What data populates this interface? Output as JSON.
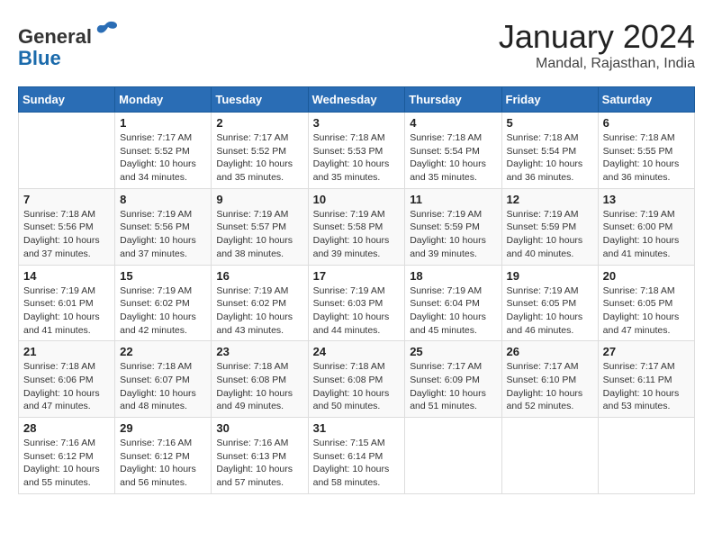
{
  "header": {
    "logo_line1": "General",
    "logo_line2": "Blue",
    "month": "January 2024",
    "location": "Mandal, Rajasthan, India"
  },
  "days_of_week": [
    "Sunday",
    "Monday",
    "Tuesday",
    "Wednesday",
    "Thursday",
    "Friday",
    "Saturday"
  ],
  "weeks": [
    [
      {
        "day": "",
        "info": ""
      },
      {
        "day": "1",
        "info": "Sunrise: 7:17 AM\nSunset: 5:52 PM\nDaylight: 10 hours\nand 34 minutes."
      },
      {
        "day": "2",
        "info": "Sunrise: 7:17 AM\nSunset: 5:52 PM\nDaylight: 10 hours\nand 35 minutes."
      },
      {
        "day": "3",
        "info": "Sunrise: 7:18 AM\nSunset: 5:53 PM\nDaylight: 10 hours\nand 35 minutes."
      },
      {
        "day": "4",
        "info": "Sunrise: 7:18 AM\nSunset: 5:54 PM\nDaylight: 10 hours\nand 35 minutes."
      },
      {
        "day": "5",
        "info": "Sunrise: 7:18 AM\nSunset: 5:54 PM\nDaylight: 10 hours\nand 36 minutes."
      },
      {
        "day": "6",
        "info": "Sunrise: 7:18 AM\nSunset: 5:55 PM\nDaylight: 10 hours\nand 36 minutes."
      }
    ],
    [
      {
        "day": "7",
        "info": "Sunrise: 7:18 AM\nSunset: 5:56 PM\nDaylight: 10 hours\nand 37 minutes."
      },
      {
        "day": "8",
        "info": "Sunrise: 7:19 AM\nSunset: 5:56 PM\nDaylight: 10 hours\nand 37 minutes."
      },
      {
        "day": "9",
        "info": "Sunrise: 7:19 AM\nSunset: 5:57 PM\nDaylight: 10 hours\nand 38 minutes."
      },
      {
        "day": "10",
        "info": "Sunrise: 7:19 AM\nSunset: 5:58 PM\nDaylight: 10 hours\nand 39 minutes."
      },
      {
        "day": "11",
        "info": "Sunrise: 7:19 AM\nSunset: 5:59 PM\nDaylight: 10 hours\nand 39 minutes."
      },
      {
        "day": "12",
        "info": "Sunrise: 7:19 AM\nSunset: 5:59 PM\nDaylight: 10 hours\nand 40 minutes."
      },
      {
        "day": "13",
        "info": "Sunrise: 7:19 AM\nSunset: 6:00 PM\nDaylight: 10 hours\nand 41 minutes."
      }
    ],
    [
      {
        "day": "14",
        "info": "Sunrise: 7:19 AM\nSunset: 6:01 PM\nDaylight: 10 hours\nand 41 minutes."
      },
      {
        "day": "15",
        "info": "Sunrise: 7:19 AM\nSunset: 6:02 PM\nDaylight: 10 hours\nand 42 minutes."
      },
      {
        "day": "16",
        "info": "Sunrise: 7:19 AM\nSunset: 6:02 PM\nDaylight: 10 hours\nand 43 minutes."
      },
      {
        "day": "17",
        "info": "Sunrise: 7:19 AM\nSunset: 6:03 PM\nDaylight: 10 hours\nand 44 minutes."
      },
      {
        "day": "18",
        "info": "Sunrise: 7:19 AM\nSunset: 6:04 PM\nDaylight: 10 hours\nand 45 minutes."
      },
      {
        "day": "19",
        "info": "Sunrise: 7:19 AM\nSunset: 6:05 PM\nDaylight: 10 hours\nand 46 minutes."
      },
      {
        "day": "20",
        "info": "Sunrise: 7:18 AM\nSunset: 6:05 PM\nDaylight: 10 hours\nand 47 minutes."
      }
    ],
    [
      {
        "day": "21",
        "info": "Sunrise: 7:18 AM\nSunset: 6:06 PM\nDaylight: 10 hours\nand 47 minutes."
      },
      {
        "day": "22",
        "info": "Sunrise: 7:18 AM\nSunset: 6:07 PM\nDaylight: 10 hours\nand 48 minutes."
      },
      {
        "day": "23",
        "info": "Sunrise: 7:18 AM\nSunset: 6:08 PM\nDaylight: 10 hours\nand 49 minutes."
      },
      {
        "day": "24",
        "info": "Sunrise: 7:18 AM\nSunset: 6:08 PM\nDaylight: 10 hours\nand 50 minutes."
      },
      {
        "day": "25",
        "info": "Sunrise: 7:17 AM\nSunset: 6:09 PM\nDaylight: 10 hours\nand 51 minutes."
      },
      {
        "day": "26",
        "info": "Sunrise: 7:17 AM\nSunset: 6:10 PM\nDaylight: 10 hours\nand 52 minutes."
      },
      {
        "day": "27",
        "info": "Sunrise: 7:17 AM\nSunset: 6:11 PM\nDaylight: 10 hours\nand 53 minutes."
      }
    ],
    [
      {
        "day": "28",
        "info": "Sunrise: 7:16 AM\nSunset: 6:12 PM\nDaylight: 10 hours\nand 55 minutes."
      },
      {
        "day": "29",
        "info": "Sunrise: 7:16 AM\nSunset: 6:12 PM\nDaylight: 10 hours\nand 56 minutes."
      },
      {
        "day": "30",
        "info": "Sunrise: 7:16 AM\nSunset: 6:13 PM\nDaylight: 10 hours\nand 57 minutes."
      },
      {
        "day": "31",
        "info": "Sunrise: 7:15 AM\nSunset: 6:14 PM\nDaylight: 10 hours\nand 58 minutes."
      },
      {
        "day": "",
        "info": ""
      },
      {
        "day": "",
        "info": ""
      },
      {
        "day": "",
        "info": ""
      }
    ]
  ]
}
